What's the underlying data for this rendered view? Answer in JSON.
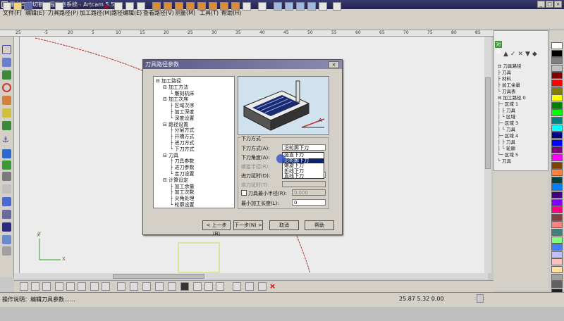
{
  "window": {
    "title": "雕刻与线切割工程信息系统 - Artcam 5.50",
    "min": "_",
    "max": "□",
    "close": "×"
  },
  "menu": [
    "文件(F)",
    "编辑(E)",
    "刀具路径(P)",
    "加工路径(M)",
    "路径编辑(E)",
    "查看路径(V)",
    "测量(M)",
    "工具(T)",
    "帮助(H)"
  ],
  "ruler_top_labels": [
    "25",
    "-5",
    "20",
    "5",
    "10",
    "15",
    "20",
    "25",
    "30",
    "35",
    "40",
    "45",
    "50",
    "55",
    "60",
    "65",
    "70",
    "75",
    "80",
    "85",
    "90"
  ],
  "dialog": {
    "title": "刀具路径参数",
    "close": "×",
    "tree": [
      {
        "t": "⊟ 加工路径",
        "lvl": 0
      },
      {
        "t": "⊟ 加工方法",
        "lvl": 1
      },
      {
        "t": "└ 雕刻机床",
        "lvl": 2
      },
      {
        "t": "⊟ 加工次序",
        "lvl": 1
      },
      {
        "t": "├ 区域次序",
        "lvl": 2
      },
      {
        "t": "├ 加工深度",
        "lvl": 2
      },
      {
        "t": "└ 深度设置",
        "lvl": 2
      },
      {
        "t": "⊟ 路径设置",
        "lvl": 1
      },
      {
        "t": "├ 分层方式",
        "lvl": 2
      },
      {
        "t": "├ 开槽方式",
        "lvl": 2
      },
      {
        "t": "├ 进刀方式",
        "lvl": 2
      },
      {
        "t": "└ 下刀方式",
        "lvl": 2
      },
      {
        "t": "⊟ 刀具",
        "lvl": 1
      },
      {
        "t": "├ 刀具参数",
        "lvl": 2
      },
      {
        "t": "├ 进刀参数",
        "lvl": 2
      },
      {
        "t": "└ 走刀设置",
        "lvl": 2
      },
      {
        "t": "⊟ 计算设定",
        "lvl": 1
      },
      {
        "t": "├ 加工余量",
        "lvl": 2
      },
      {
        "t": "├ 加工次数",
        "lvl": 2
      },
      {
        "t": "├ 尖角处理",
        "lvl": 2
      },
      {
        "t": "└ 轮廓设置",
        "lvl": 2
      }
    ],
    "preview_label": "A",
    "group_title": "下刀方式",
    "params": [
      {
        "label": "下刀方式(A):",
        "value": "沿轮廓下刀",
        "disabled": false
      },
      {
        "label": "下刀角度(A):",
        "value": "",
        "disabled": false
      },
      {
        "label": "螺旋半径(R):",
        "value": "",
        "disabled": true
      },
      {
        "label": "进刀延时(D):",
        "value": "",
        "disabled": false
      },
      {
        "label": "退刀延时(T):",
        "value": "",
        "disabled": true
      }
    ],
    "checkbox_label": "刀具最小半径(R):",
    "checkbox_value": "0.000",
    "last_label": "最小加工长度(L):",
    "last_value": "0",
    "dropdown_options": [
      "竖直下刀",
      "沿轮廓下刀",
      "螺旋下刀",
      "折线下刀",
      "直线下刀"
    ],
    "buttons": {
      "back": "< 上一步(B)",
      "next": "下一步(N) >",
      "cancel": "取消",
      "help": "帮助"
    }
  },
  "right_panel": {
    "tab": "对象",
    "tree": [
      "⊟ 刀具路径",
      "├ 刀具",
      "├ 材料",
      "├ 加工余量",
      "└ 刀具表",
      "⊟ 加工路径 0",
      "├─ 区域 1",
      "│  ├ 刀具",
      "│  └ 区域",
      "├─ 区域 3",
      "│  └ 刀具",
      "├─ 区域 4",
      "│  ├ 刀具",
      "│  └ 轮廓",
      "└─ 区域 5",
      "   └ 刀具"
    ]
  },
  "canvas": {
    "axis_y": "Y",
    "axis_x": "X"
  },
  "status": {
    "text": "操作说明：编辑刀具参数……",
    "coords": "25.87  5.32  0.00"
  },
  "palette_colors": [
    "#ffffff",
    "#000000",
    "#808080",
    "#c0c0c0",
    "#800000",
    "#ff0000",
    "#808000",
    "#ffff00",
    "#008000",
    "#00ff00",
    "#008080",
    "#00ffff",
    "#000080",
    "#0000ff",
    "#800080",
    "#ff00ff",
    "#804000",
    "#ff8040",
    "#004040",
    "#0080ff",
    "#400080",
    "#8000ff",
    "#ff0080",
    "#804040",
    "#ff8080",
    "#408080",
    "#80ff80",
    "#4080ff",
    "#c0c0ff",
    "#ffc0c0",
    "#ffe0a0",
    "#a0a0a0",
    "#606060",
    "#202020"
  ]
}
